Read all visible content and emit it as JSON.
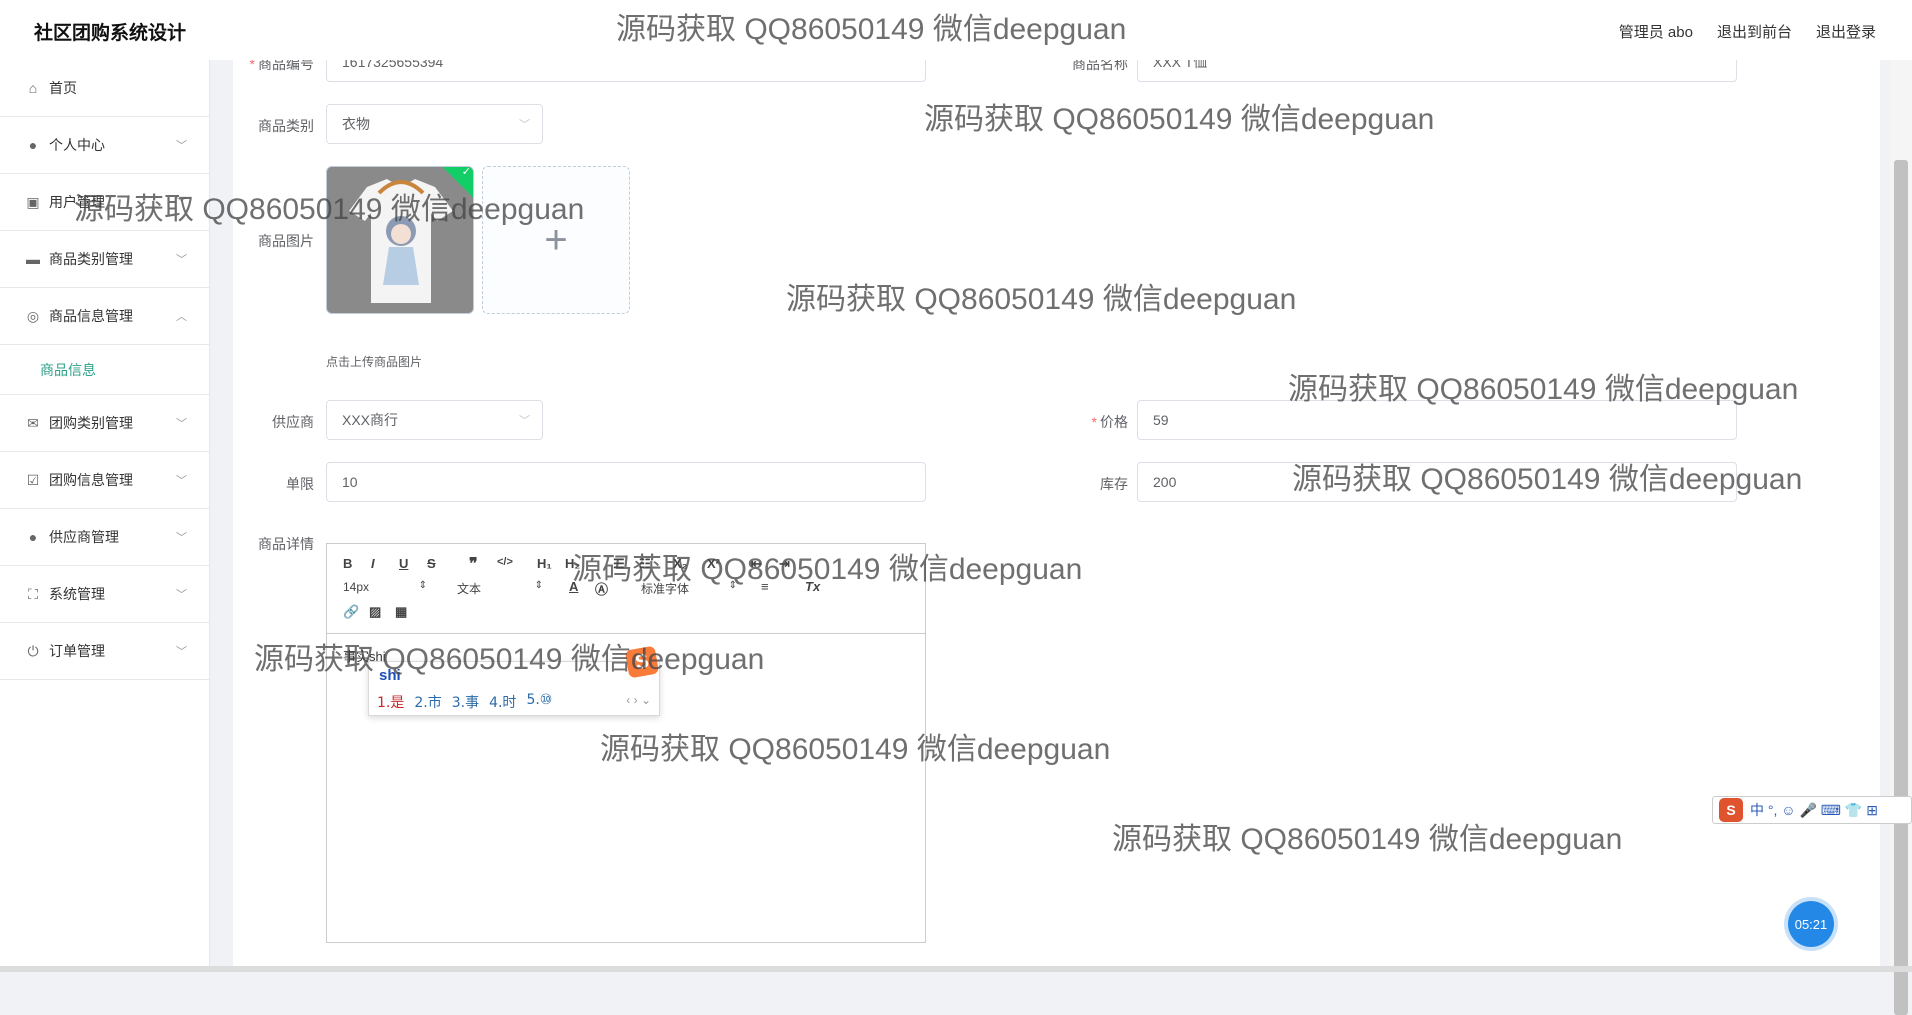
{
  "app": {
    "title": "社区团购系统设计"
  },
  "header": {
    "admin_label": "管理员 abo",
    "exit_front": "退出到前台",
    "logout": "退出登录"
  },
  "sidebar": {
    "items": [
      {
        "label": "首页",
        "icon": "home-icon"
      },
      {
        "label": "个人中心",
        "icon": "user-icon"
      },
      {
        "label": "用户管理",
        "icon": "chart-icon"
      },
      {
        "label": "商品类别管理",
        "icon": "briefcase-icon"
      },
      {
        "label": "商品信息管理",
        "icon": "target-icon"
      },
      {
        "label": "团购类别管理",
        "icon": "mail-icon"
      },
      {
        "label": "团购信息管理",
        "icon": "clipboard-icon"
      },
      {
        "label": "供应商管理",
        "icon": "user-icon"
      },
      {
        "label": "系统管理",
        "icon": "fullscreen-icon"
      },
      {
        "label": "订单管理",
        "icon": "power-icon"
      }
    ],
    "active_sub": "商品信息"
  },
  "form": {
    "code_label": "商品编号",
    "code_value": "1617325655394",
    "name_label": "商品名称",
    "name_value": "XXX T恤",
    "category_label": "商品类别",
    "category_value": "衣物",
    "image_label": "商品图片",
    "upload_hint": "点击上传商品图片",
    "supplier_label": "供应商",
    "supplier_value": "XXX商行",
    "price_label": "价格",
    "price_value": "59",
    "limit_label": "单限",
    "limit_value": "10",
    "stock_label": "库存",
    "stock_value": "200",
    "detail_label": "商品详情"
  },
  "editor": {
    "font_size": "14px",
    "text_type": "文本",
    "font_family": "标准字体",
    "content": "事实shi"
  },
  "ime": {
    "composition": "shi",
    "candidates": [
      "1.是",
      "2.市",
      "3.事",
      "4.时",
      "5.⑩"
    ],
    "bar_text": "中 °, ☺ 🎤 ⌨ 👕 ⊞"
  },
  "timer": "05:21",
  "watermark": "源码获取 QQ86050149 微信deepguan"
}
